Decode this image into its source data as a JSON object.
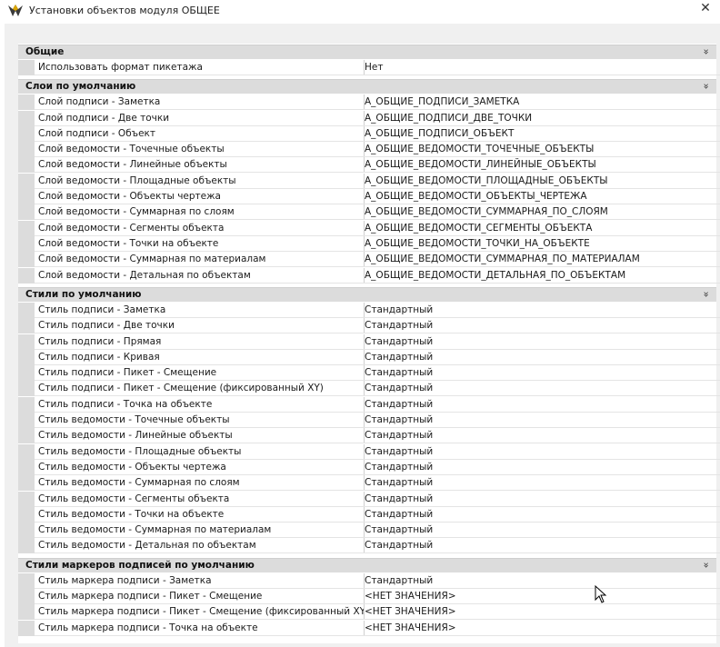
{
  "window": {
    "title": "Установки объектов модуля ОБЩЕЕ",
    "close_glyph": "✕",
    "collapse_glyph": "»"
  },
  "sections": [
    {
      "title": "Общие",
      "rows": [
        {
          "name": "Использовать формат пикетажа",
          "value": "Нет"
        }
      ]
    },
    {
      "title": "Слои по умолчанию",
      "rows": [
        {
          "name": "Слой подписи - Заметка",
          "value": "А_ОБЩИЕ_ПОДПИСИ_ЗАМЕТКА"
        },
        {
          "name": "Слой подписи - Две точки",
          "value": "А_ОБЩИЕ_ПОДПИСИ_ДВЕ_ТОЧКИ"
        },
        {
          "name": "Слой подписи - Объект",
          "value": "А_ОБЩИЕ_ПОДПИСИ_ОБЪЕКТ"
        },
        {
          "name": "Слой ведомости - Точечные объекты",
          "value": "А_ОБЩИЕ_ВЕДОМОСТИ_ТОЧЕЧНЫЕ_ОБЪЕКТЫ"
        },
        {
          "name": "Слой ведомости - Линейные объекты",
          "value": "А_ОБЩИЕ_ВЕДОМОСТИ_ЛИНЕЙНЫЕ_ОБЪЕКТЫ"
        },
        {
          "name": "Слой ведомости - Площадные объекты",
          "value": "А_ОБЩИЕ_ВЕДОМОСТИ_ПЛОЩАДНЫЕ_ОБЪЕКТЫ"
        },
        {
          "name": "Слой ведомости - Объекты чертежа",
          "value": "А_ОБЩИЕ_ВЕДОМОСТИ_ОБЪЕКТЫ_ЧЕРТЕЖА"
        },
        {
          "name": "Слой ведомости - Суммарная по слоям",
          "value": "А_ОБЩИЕ_ВЕДОМОСТИ_СУММАРНАЯ_ПО_СЛОЯМ"
        },
        {
          "name": "Слой ведомости - Сегменты объекта",
          "value": "А_ОБЩИЕ_ВЕДОМОСТИ_СЕГМЕНТЫ_ОБЪЕКТА"
        },
        {
          "name": "Слой ведомости - Точки на объекте",
          "value": "А_ОБЩИЕ_ВЕДОМОСТИ_ТОЧКИ_НА_ОБЪЕКТЕ"
        },
        {
          "name": "Слой ведомости - Суммарная по материалам",
          "value": "А_ОБЩИЕ_ВЕДОМОСТИ_СУММАРНАЯ_ПО_МАТЕРИАЛАМ"
        },
        {
          "name": "Слой ведомости - Детальная по объектам",
          "value": "А_ОБЩИЕ_ВЕДОМОСТИ_ДЕТАЛЬНАЯ_ПО_ОБЪЕКТАМ"
        }
      ]
    },
    {
      "title": "Стили по умолчанию",
      "rows": [
        {
          "name": "Стиль подписи - Заметка",
          "value": "Стандартный"
        },
        {
          "name": "Стиль подписи - Две точки",
          "value": "Стандартный"
        },
        {
          "name": "Стиль подписи - Прямая",
          "value": "Стандартный"
        },
        {
          "name": "Стиль подписи - Кривая",
          "value": "Стандартный"
        },
        {
          "name": "Стиль подписи - Пикет - Смещение",
          "value": "Стандартный"
        },
        {
          "name": "Стиль подписи - Пикет - Смещение  (фиксированный XY)",
          "value": "Стандартный"
        },
        {
          "name": "Стиль подписи - Точка на объекте",
          "value": "Стандартный"
        },
        {
          "name": "Стиль ведомости - Точечные объекты",
          "value": "Стандартный"
        },
        {
          "name": "Стиль ведомости - Линейные объекты",
          "value": "Стандартный"
        },
        {
          "name": "Стиль ведомости - Площадные объекты",
          "value": "Стандартный"
        },
        {
          "name": "Стиль ведомости - Объекты чертежа",
          "value": "Стандартный"
        },
        {
          "name": "Стиль ведомости - Суммарная по слоям",
          "value": "Стандартный"
        },
        {
          "name": "Стиль ведомости - Сегменты объекта",
          "value": "Стандартный"
        },
        {
          "name": "Стиль ведомости - Точки на объекте",
          "value": "Стандартный"
        },
        {
          "name": "Стиль ведомости - Суммарная по материалам",
          "value": "Стандартный"
        },
        {
          "name": "Стиль ведомости - Детальная по объектам",
          "value": "Стандартный"
        }
      ]
    },
    {
      "title": "Стили маркеров подписей по умолчанию",
      "rows": [
        {
          "name": "Стиль маркера подписи - Заметка",
          "value": "Стандартный"
        },
        {
          "name": "Стиль маркера подписи - Пикет - Смещение",
          "value": "<НЕТ ЗНАЧЕНИЯ>"
        },
        {
          "name": "Стиль маркера подписи - Пикет - Смещение (фиксированный XY)",
          "value": "<НЕТ ЗНАЧЕНИЯ>"
        },
        {
          "name": "Стиль маркера подписи - Точка на объекте",
          "value": "<НЕТ ЗНАЧЕНИЯ>"
        }
      ]
    }
  ]
}
